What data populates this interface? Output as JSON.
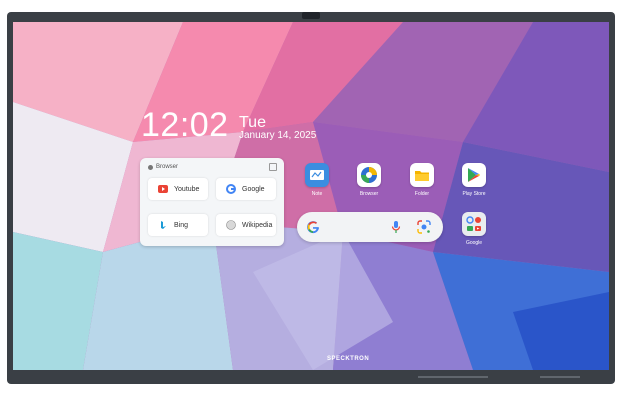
{
  "clock": {
    "time": "12:02",
    "day": "Tue",
    "date": "January 14, 2025"
  },
  "browser_widget": {
    "title": "Browser",
    "tiles": [
      {
        "label": "Youtube",
        "icon": "youtube-icon"
      },
      {
        "label": "Google",
        "icon": "google-icon"
      },
      {
        "label": "Bing",
        "icon": "bing-icon"
      },
      {
        "label": "Wikipedia",
        "icon": "wikipedia-icon"
      }
    ]
  },
  "apps": [
    {
      "label": "Note",
      "icon": "note-icon"
    },
    {
      "label": "Browser",
      "icon": "browser-icon"
    },
    {
      "label": "Folder",
      "icon": "folder-icon"
    },
    {
      "label": "Play Store",
      "icon": "play-store-icon"
    },
    {
      "label": "Google",
      "icon": "google-apps-folder-icon"
    }
  ],
  "search_bar": {
    "icons": [
      "google-g-icon",
      "mic-icon",
      "lens-icon"
    ]
  },
  "device": {
    "brand": "SPECKTRON"
  },
  "colors": {
    "bezel": "#3a3f45",
    "google_blue": "#4285F4",
    "google_red": "#EA4335",
    "google_yellow": "#FBBC05",
    "google_green": "#34A853"
  }
}
